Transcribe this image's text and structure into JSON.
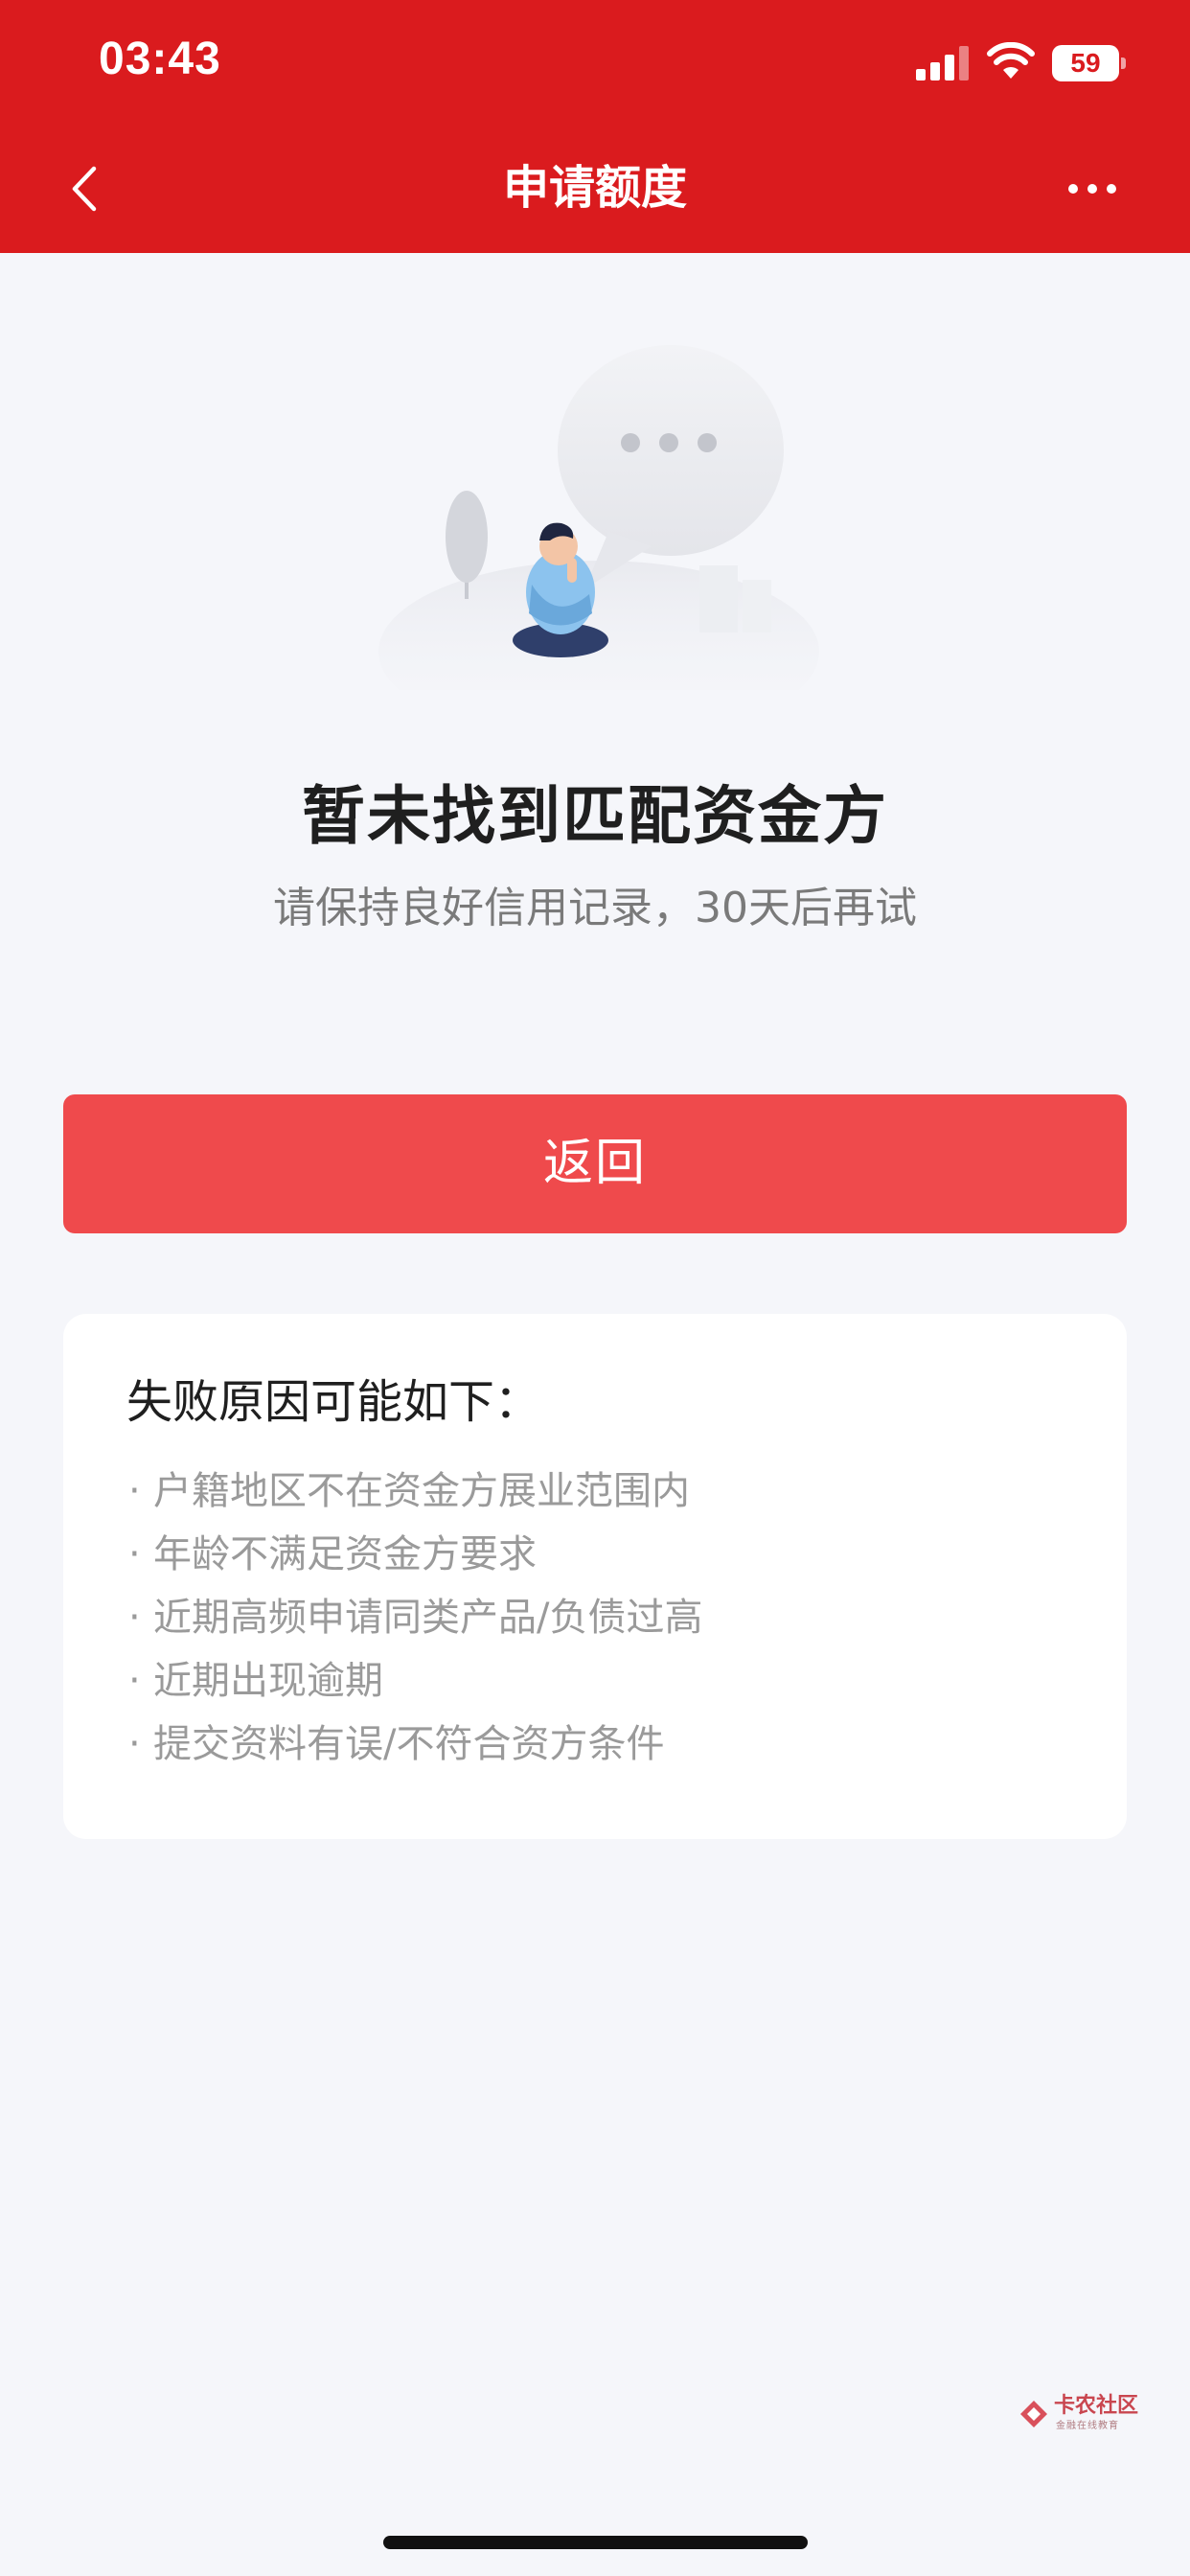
{
  "status_bar": {
    "time": "03:43",
    "battery_level": "59",
    "icons": [
      "signal-icon",
      "wifi-icon",
      "battery-icon"
    ]
  },
  "nav": {
    "title": "申请额度",
    "back_icon": "chevron-left-icon",
    "more_icon": "more-horizontal-icon"
  },
  "result": {
    "illustration": "person-thinking-illustration",
    "title": "暂未找到匹配资金方",
    "subtitle": "请保持良好信用记录，30天后再试"
  },
  "actions": {
    "return_label": "返回"
  },
  "reasons": {
    "title": "失败原因可能如下：",
    "bullet": "·",
    "items": [
      "户籍地区不在资金方展业范围内",
      "年龄不满足资金方要求",
      "近期高频申请同类产品/负债过高",
      "近期出现逾期",
      "提交资料有误/不符合资方条件"
    ]
  },
  "watermark": {
    "name": "卡农社区",
    "slogan": "金融在线教育"
  },
  "colors": {
    "header_red": "#da1b1e",
    "button_red": "#ef4a4c",
    "page_bg": "#f5f6fa",
    "card_bg": "#ffffff",
    "muted_text": "#9a9a9a"
  }
}
